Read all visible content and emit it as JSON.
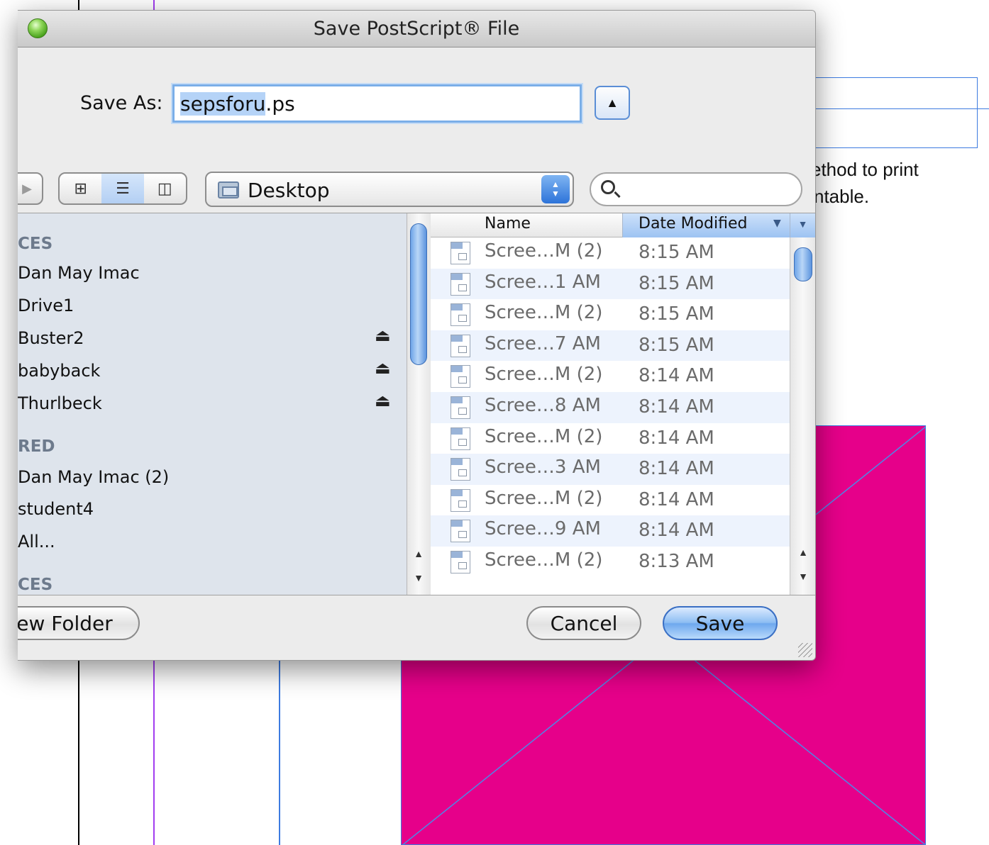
{
  "dialog": {
    "title": "Save PostScript® File",
    "save_as_label": "Save As:",
    "filename_selected": "sepsforu",
    "filename_ext": ".ps",
    "location": "Desktop",
    "search_placeholder": ""
  },
  "sidebar": {
    "headers": [
      "CES",
      "RED",
      "CES"
    ],
    "devices": [
      "Dan May Imac",
      "Drive1",
      "Buster2",
      "babyback",
      "Thurlbeck"
    ],
    "shared": [
      "Dan May Imac (2)",
      "student4",
      "All..."
    ]
  },
  "file_list": {
    "columns": {
      "name": "Name",
      "date": "Date Modified"
    },
    "rows": [
      {
        "name": "Scree…M (2)",
        "date": "8:15 AM"
      },
      {
        "name": "Scree…1 AM",
        "date": "8:15 AM"
      },
      {
        "name": "Scree…M (2)",
        "date": "8:15 AM"
      },
      {
        "name": "Scree…7 AM",
        "date": "8:15 AM"
      },
      {
        "name": "Scree…M (2)",
        "date": "8:14 AM"
      },
      {
        "name": "Scree…8 AM",
        "date": "8:14 AM"
      },
      {
        "name": "Scree…M (2)",
        "date": "8:14 AM"
      },
      {
        "name": "Scree…3 AM",
        "date": "8:14 AM"
      },
      {
        "name": "Scree…M (2)",
        "date": "8:14 AM"
      },
      {
        "name": "Scree…9 AM",
        "date": "8:14 AM"
      },
      {
        "name": "Scree…M (2)",
        "date": "8:13 AM"
      }
    ]
  },
  "buttons": {
    "new_folder": "ew Folder",
    "cancel": "Cancel",
    "save": "Save"
  },
  "background": {
    "text_line1": "ethod to print",
    "text_line2": "ntable."
  }
}
